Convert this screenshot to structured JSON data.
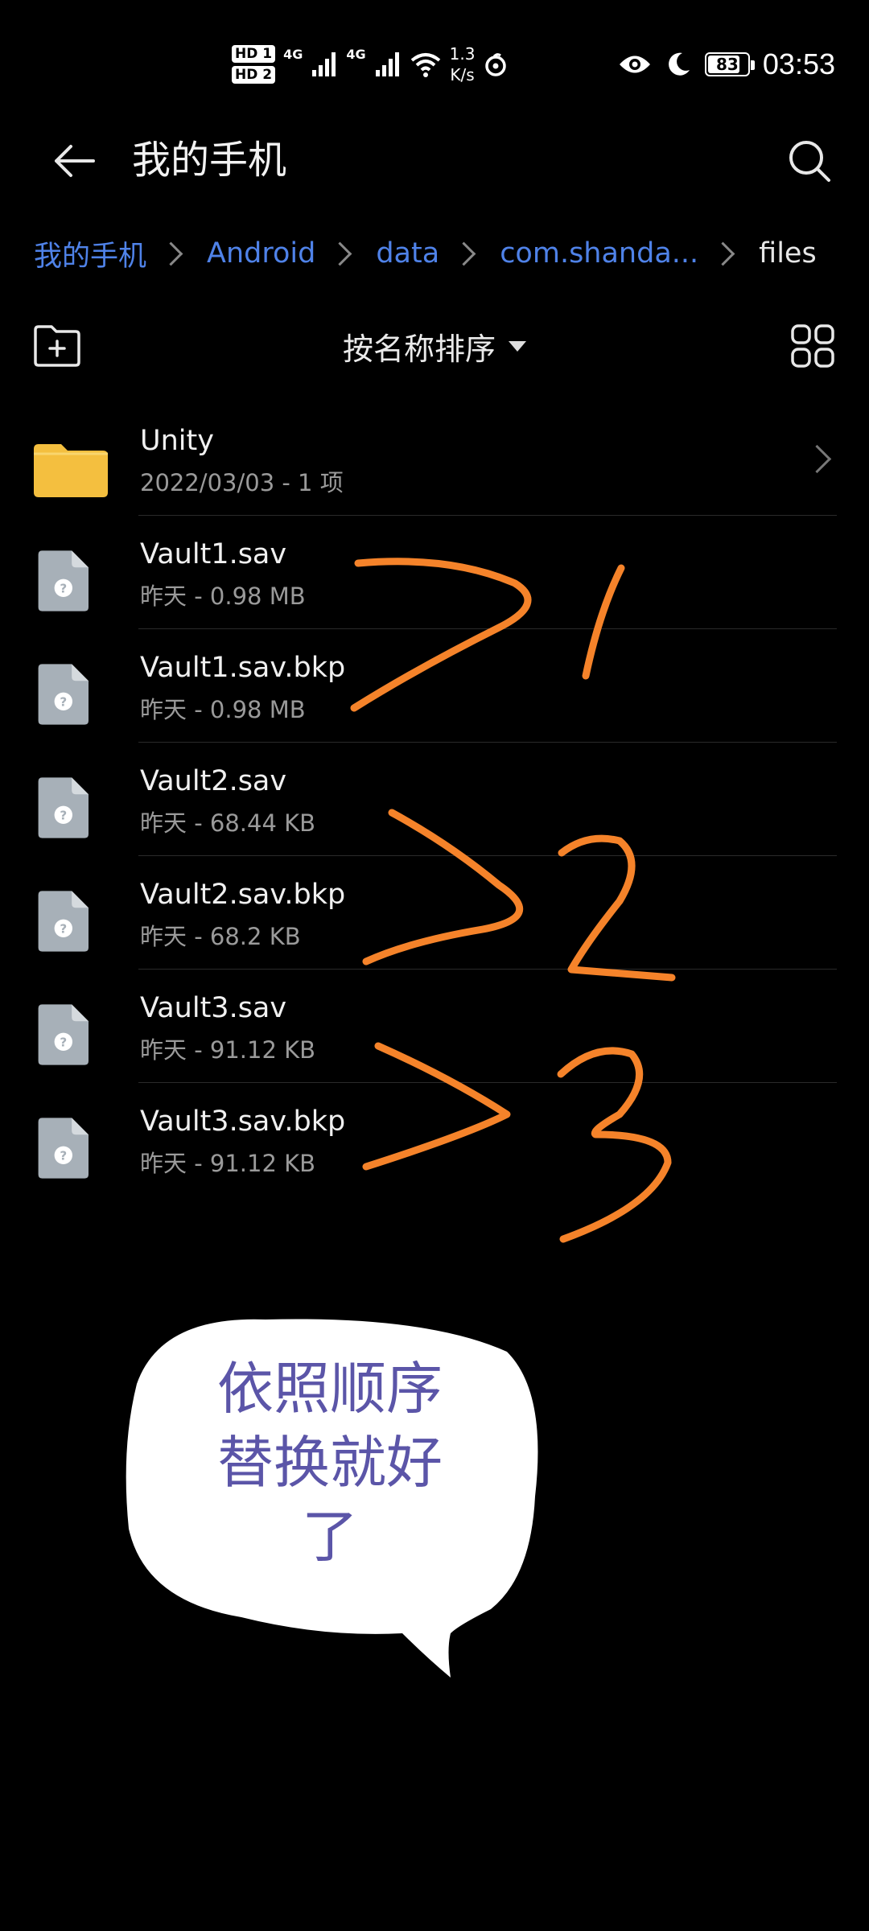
{
  "status_bar": {
    "hd1": "HD 1",
    "hd2": "HD 2",
    "net1": "4G",
    "net2": "4G",
    "speed_value": "1.3",
    "speed_unit": "K/s",
    "battery": "83",
    "battery_level": 0.83,
    "time": "03:53"
  },
  "header": {
    "title": "我的手机"
  },
  "breadcrumb": [
    {
      "label": "我的手机"
    },
    {
      "label": "Android"
    },
    {
      "label": "data"
    },
    {
      "label": "com.shanda..."
    },
    {
      "label": "files"
    }
  ],
  "toolbar": {
    "sort_label": "按名称排序"
  },
  "files": [
    {
      "name": "Unity",
      "meta": "2022/03/03 - 1 项",
      "type": "folder"
    },
    {
      "name": "Vault1.sav",
      "meta": "昨天 - 0.98 MB",
      "type": "file"
    },
    {
      "name": "Vault1.sav.bkp",
      "meta": "昨天 - 0.98 MB",
      "type": "file"
    },
    {
      "name": "Vault2.sav",
      "meta": "昨天 - 68.44 KB",
      "type": "file"
    },
    {
      "name": "Vault2.sav.bkp",
      "meta": "昨天 - 68.2 KB",
      "type": "file"
    },
    {
      "name": "Vault3.sav",
      "meta": "昨天 - 91.12 KB",
      "type": "file"
    },
    {
      "name": "Vault3.sav.bkp",
      "meta": "昨天 - 91.12 KB",
      "type": "file"
    }
  ],
  "annotation": {
    "stroke_color": "#f5832a",
    "bubble_lines": [
      "依照顺序",
      "替换就好",
      "了"
    ],
    "bubble_text_color": "#5b55a8"
  },
  "colors": {
    "accent": "#4f82e8",
    "folder": "#f4bf3f",
    "file_icon": "#a7b0b8"
  }
}
